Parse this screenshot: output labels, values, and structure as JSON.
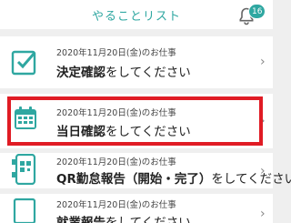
{
  "header": {
    "title": "やることリスト",
    "notification_count": "16"
  },
  "tasks": [
    {
      "date": "2020年11月20日(金)のお仕事",
      "title_bold": "決定確認",
      "title_rest": "をしてください",
      "icon": "checkbox-icon"
    },
    {
      "date": "2020年11月20日(金)のお仕事",
      "title_bold": "当日確認",
      "title_rest": "をしてください",
      "icon": "calendar-icon"
    },
    {
      "date": "2020年11月20日(金)のお仕事",
      "title_bold": "QR勤怠報告（開始・完了）",
      "title_rest": "をしてください",
      "icon": "qr-phone-icon"
    },
    {
      "date": "2020年11月20日(金)のお仕事",
      "title_bold": "就業報告",
      "title_rest": "をしてください",
      "icon": "report-icon"
    }
  ],
  "colors": {
    "accent": "#2fa7a1",
    "highlight": "#e01b24"
  }
}
